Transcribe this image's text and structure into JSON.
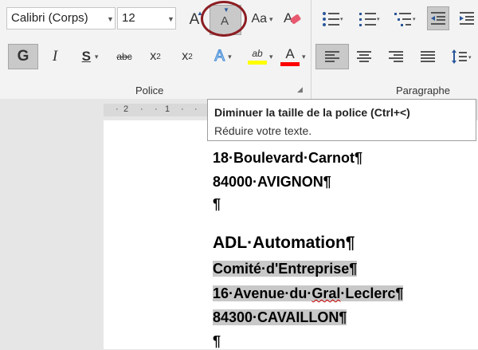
{
  "ribbon": {
    "font_name": "Calibri (Corps)",
    "font_size": "12",
    "buttons": {
      "grow_font": "A",
      "shrink_font": "A",
      "change_case": "Aa",
      "bold": "G",
      "italic": "I",
      "underline": "S",
      "strikethrough": "abc",
      "subscript": "x",
      "subscript_mark": "2",
      "superscript": "x",
      "superscript_mark": "2",
      "text_effects": "A",
      "highlight": "ab",
      "font_color": "A"
    },
    "groups": {
      "police": "Police",
      "paragraphe": "Paragraphe"
    },
    "colors": {
      "highlight": "#ffff00",
      "font_color": "#ff0000",
      "accent_blue": "#2b579a",
      "circle": "#8b1d22"
    }
  },
  "ruler": {
    "ticks": [
      "2",
      "1"
    ]
  },
  "tooltip": {
    "title": "Diminuer la taille de la police (Ctrl+<)",
    "description": "Réduire votre texte."
  },
  "document": {
    "lines": [
      "18·Boulevard·Carnot¶",
      "84000·AVIGNON¶",
      "¶",
      "ADL·Automation¶",
      "Comité·d'Entreprise¶",
      "16·Avenue·du·",
      "Gral",
      "·Leclerc¶",
      "84300·CAVAILLON¶",
      "¶"
    ]
  }
}
